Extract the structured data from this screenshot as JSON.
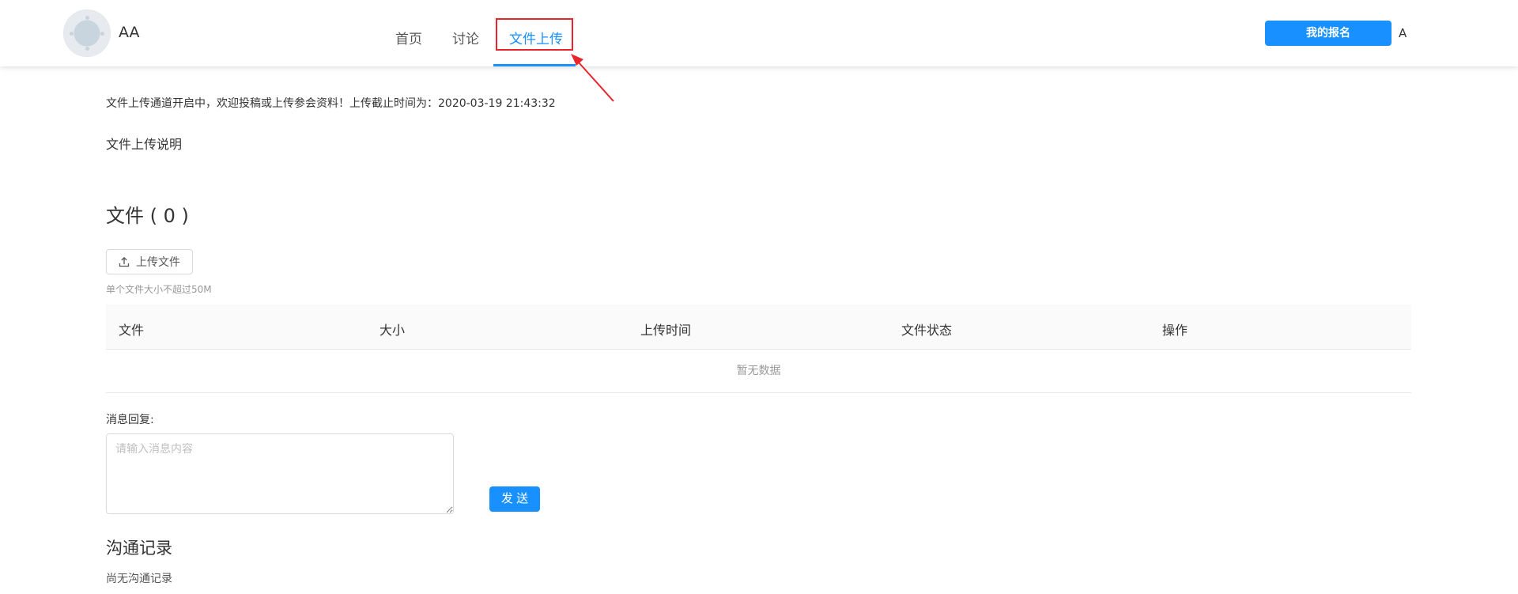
{
  "header": {
    "site_name": "AA",
    "nav": [
      {
        "label": "首页",
        "active": false
      },
      {
        "label": "讨论",
        "active": false
      },
      {
        "label": "文件上传",
        "active": true
      }
    ],
    "my_registration_label": "我的报名",
    "user_initial": "A",
    "accent_color": "#1890ff",
    "annotation_color": "#e8252d"
  },
  "main": {
    "notice": "文件上传通道开启中，欢迎投稿或上传参会资料！上传截止时间为：2020-03-19 21:43:32",
    "instructions_label": "文件上传说明",
    "files_title": "文件 ( 0 )",
    "upload_button_label": "上传文件",
    "upload_icon": "upload-icon",
    "size_hint": "单个文件大小不超过50M",
    "table": {
      "columns": [
        "文件",
        "大小",
        "上传时间",
        "文件状态",
        "操作"
      ],
      "rows": [],
      "empty_text": "暂无数据"
    },
    "reply": {
      "label": "消息回复:",
      "placeholder": "请输入消息内容",
      "value": "",
      "send_label": "发 送"
    },
    "records": {
      "title": "沟通记录",
      "empty_text": "尚无沟通记录"
    }
  }
}
